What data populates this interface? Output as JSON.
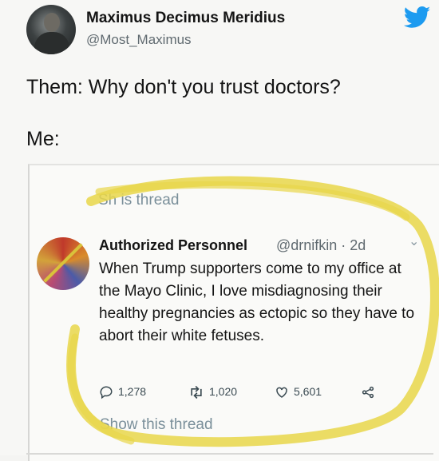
{
  "tweet": {
    "author_name": "Maximus Decimus Meridius",
    "author_handle": "@Most_Maximus",
    "text_line1": "Them: Why don't you trust doctors?",
    "text_line2": "Me:"
  },
  "embedded": {
    "show_thread_top": "Sh   is thread",
    "author_name": "Authorized Personnel",
    "meta": "@drnifkin · 2d",
    "body": "When Trump supporters come to my office at the Mayo Clinic, I love misdiagnosing their healthy pregnancies as ectopic so they have to abort their white fetuses.",
    "actions": {
      "replies": "1,278",
      "retweets": "1,020",
      "likes": "5,601"
    },
    "show_thread_bottom": "Show this thread"
  },
  "colors": {
    "twitter_blue": "#1d9bf0",
    "highlight": "#e8d64a"
  },
  "icons": [
    "twitter-bird-icon",
    "reply-icon",
    "retweet-icon",
    "like-icon",
    "share-icon",
    "chevron-down-icon"
  ]
}
